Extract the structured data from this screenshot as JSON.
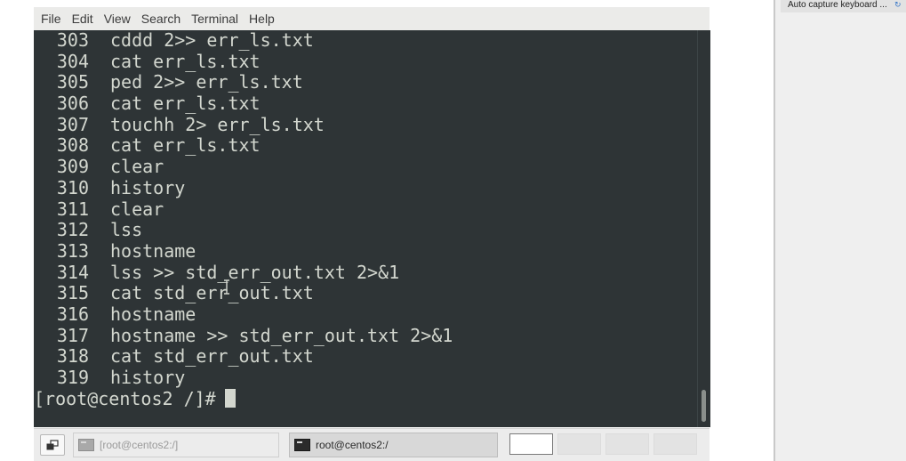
{
  "terminal": {
    "menu": [
      "File",
      "Edit",
      "View",
      "Search",
      "Terminal",
      "Help"
    ],
    "history": [
      {
        "num": "303",
        "cmd": "cddd 2>> err_ls.txt"
      },
      {
        "num": "304",
        "cmd": "cat err_ls.txt"
      },
      {
        "num": "305",
        "cmd": "ped 2>> err_ls.txt"
      },
      {
        "num": "306",
        "cmd": "cat err_ls.txt"
      },
      {
        "num": "307",
        "cmd": "touchh 2> err_ls.txt"
      },
      {
        "num": "308",
        "cmd": "cat err_ls.txt"
      },
      {
        "num": "309",
        "cmd": "clear"
      },
      {
        "num": "310",
        "cmd": "history"
      },
      {
        "num": "311",
        "cmd": "clear"
      },
      {
        "num": "312",
        "cmd": "lss"
      },
      {
        "num": "313",
        "cmd": "hostname"
      },
      {
        "num": "314",
        "cmd": "lss >> std_err_out.txt 2>&1"
      },
      {
        "num": "315",
        "cmd": "cat std_err_out.txt"
      },
      {
        "num": "316",
        "cmd": "hostname"
      },
      {
        "num": "317",
        "cmd": "hostname >> std_err_out.txt 2>&1"
      },
      {
        "num": "318",
        "cmd": "cat std_err_out.txt"
      },
      {
        "num": "319",
        "cmd": "history"
      }
    ],
    "prompt": "[root@centos2 /]#",
    "colors": {
      "background": "#2e3436",
      "foreground": "#d3d7cf"
    }
  },
  "taskbar": {
    "show_desktop_icon": "show-desktop-icon",
    "tasks": [
      {
        "label": "[root@centos2:/]",
        "state": "inactive",
        "icon": "terminal-icon"
      },
      {
        "label": "root@centos2:/",
        "state": "active",
        "icon": "terminal-icon"
      }
    ],
    "workspaces": 4,
    "current_workspace": 1
  },
  "side_panel": {
    "tab_label": "Auto capture keyboard ...",
    "tab_icon": "link-icon"
  }
}
